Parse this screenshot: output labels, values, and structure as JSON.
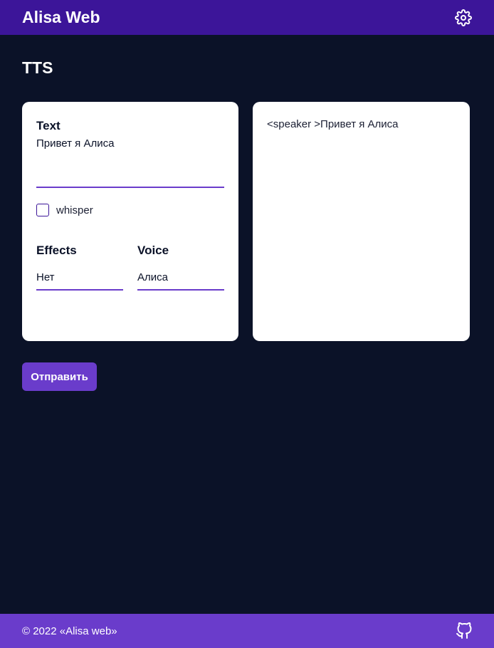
{
  "header": {
    "app_title": "Alisa Web",
    "settings_icon": "gear-icon"
  },
  "page": {
    "title": "TTS"
  },
  "form": {
    "text_label": "Text",
    "text_value": "Привет я Алиса",
    "whisper_label": "whisper",
    "whisper_checked": false,
    "effects_label": "Effects",
    "effects_value": "Нет",
    "voice_label": "Voice",
    "voice_value": "Алиса"
  },
  "output": {
    "text": "<speaker >Привет я Алиса"
  },
  "actions": {
    "submit_label": "Отправить"
  },
  "footer": {
    "copyright": "© 2022 «Alisa web»",
    "github_icon": "github-icon"
  },
  "colors": {
    "header_bg": "#3c1599",
    "page_bg": "#0b1228",
    "accent": "#6a3ccb",
    "card_bg": "#ffffff"
  }
}
